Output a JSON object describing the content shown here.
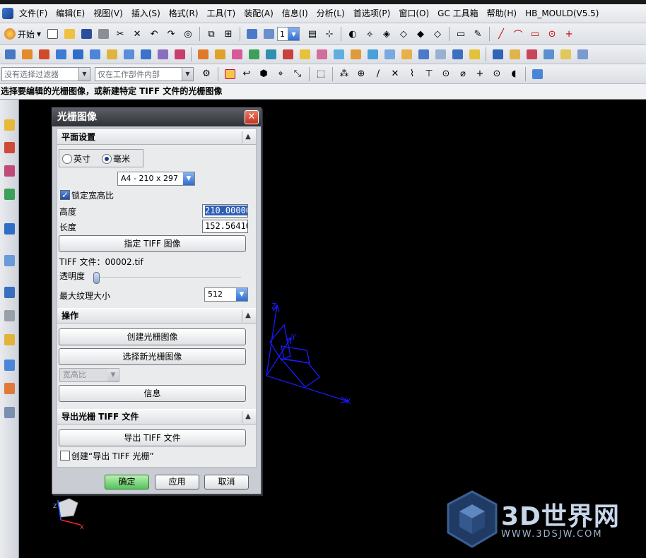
{
  "menubar": {
    "items": [
      "文件(F)",
      "编辑(E)",
      "视图(V)",
      "插入(S)",
      "格式(R)",
      "工具(T)",
      "装配(A)",
      "信息(I)",
      "分析(L)",
      "首选项(P)",
      "窗口(O)",
      "GC 工具箱",
      "帮助(H)",
      "HB_MOULD(V5.5)"
    ]
  },
  "toolbar1": {
    "start_label": "开始",
    "layer_value": "1"
  },
  "toolbar3": {
    "filter_placeholder": "没有选择过滤器",
    "scope_placeholder": "仅在工作部件内部"
  },
  "status": {
    "prompt": "选择要编辑的光栅图像，或新建特定 TIFF 文件的光栅图像"
  },
  "dialog": {
    "title": "光栅图像",
    "plane_section": {
      "title": "平面设置",
      "unit_inch": "英寸",
      "unit_mm": "毫米",
      "selected_unit": "毫米",
      "paper_size": "A4 - 210 x 297",
      "lock_aspect_label": "锁定宽高比",
      "lock_aspect_checked": true,
      "height_label": "高度",
      "height_value": "210.00000",
      "length_label": "长度",
      "length_value": "152.56410",
      "specify_tiff_button": "指定 TIFF 图像",
      "tiff_file_label": "TIFF 文件：00002.tif",
      "transparency_label": "透明度",
      "transparency": 0,
      "max_texture_label": "最大纹理大小",
      "max_texture_value": "512"
    },
    "ops_section": {
      "title": "操作",
      "create_button": "创建光栅图像",
      "select_new_button": "选择新光栅图像",
      "aspect_select": "宽高比",
      "info_button": "信息"
    },
    "export_section": {
      "title": "导出光栅 TIFF 文件",
      "export_button": "导出 TIFF 文件",
      "create_export_label": "创建“导出 TIFF 光栅”",
      "create_export_checked": false
    },
    "footer": {
      "ok": "确定",
      "apply": "应用",
      "cancel": "取消"
    }
  },
  "viewport": {
    "axis_labels": [
      "Z",
      "Y",
      "X"
    ],
    "triad_axis_labels": [
      "Z",
      "X"
    ]
  },
  "watermark": {
    "title": "3D世界网",
    "url": "WWW.3DSJW.COM"
  },
  "colors": {
    "axis_blue": "#1a1aff",
    "ok_green": "#55c25a",
    "dialog_title": "#2f3237",
    "close_red": "#c4321f"
  }
}
